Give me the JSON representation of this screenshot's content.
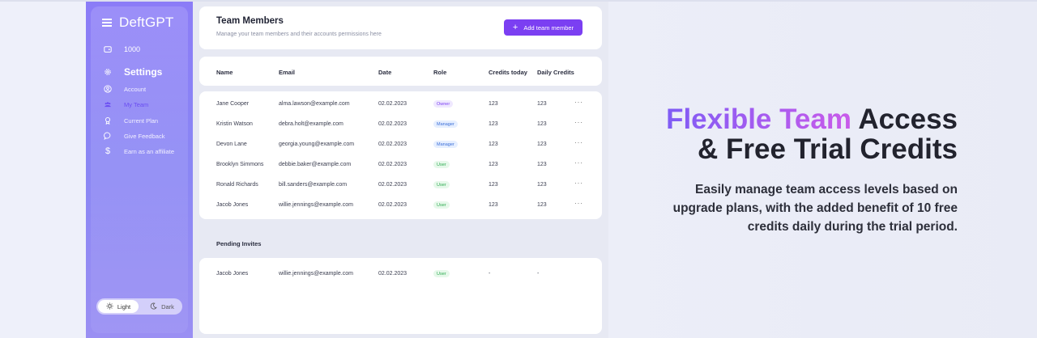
{
  "brand": {
    "name": "DeftGPT"
  },
  "credits": {
    "value": "1000"
  },
  "nav": {
    "heading": "Settings",
    "items": [
      {
        "label": "Account",
        "icon": "account-icon"
      },
      {
        "label": "My Team",
        "icon": "team-icon",
        "active": true
      },
      {
        "label": "Current Plan",
        "icon": "plan-icon"
      },
      {
        "label": "Give Feedback",
        "icon": "feedback-icon"
      },
      {
        "label": "Earn as an affiliate",
        "icon": "dollar-icon"
      }
    ]
  },
  "theme": {
    "light": "Light",
    "dark": "Dark"
  },
  "header": {
    "title": "Team Members",
    "subtitle": "Manage your team members and their accounts permissions here",
    "add_button": "Add team member"
  },
  "table": {
    "columns": [
      "Name",
      "Email",
      "Date",
      "Role",
      "Credits today",
      "Daily Credits"
    ],
    "rows": [
      {
        "name": "Jane Cooper",
        "email": "alma.lawson@example.com",
        "date": "02.02.2023",
        "role": "Owner",
        "credits_today": "123",
        "daily_credits": "123"
      },
      {
        "name": "Kristin Watson",
        "email": "debra.holt@example.com",
        "date": "02.02.2023",
        "role": "Manager",
        "credits_today": "123",
        "daily_credits": "123"
      },
      {
        "name": "Devon Lane",
        "email": "georgia.young@example.com",
        "date": "02.02.2023",
        "role": "Manager",
        "credits_today": "123",
        "daily_credits": "123"
      },
      {
        "name": "Brooklyn Simmons",
        "email": "debbie.baker@example.com",
        "date": "02.02.2023",
        "role": "User",
        "credits_today": "123",
        "daily_credits": "123"
      },
      {
        "name": "Ronald Richards",
        "email": "bill.sanders@example.com",
        "date": "02.02.2023",
        "role": "User",
        "credits_today": "123",
        "daily_credits": "123"
      },
      {
        "name": "Jacob Jones",
        "email": "willie.jennings@example.com",
        "date": "02.02.2023",
        "role": "User",
        "credits_today": "123",
        "daily_credits": "123"
      }
    ]
  },
  "pending": {
    "title": "Pending Invites",
    "rows": [
      {
        "name": "Jacob Jones",
        "email": "willie.jennings@example.com",
        "date": "02.02.2023",
        "role": "User",
        "credits_today": "-",
        "daily_credits": "-"
      }
    ]
  },
  "marketing": {
    "headline_gradient": "Flexible Team",
    "headline_rest": "Access",
    "headline_line2": "& Free Trial Credits",
    "body": "Easily manage team access levels based on upgrade plans, with the added benefit of 10 free credits daily during the trial period."
  },
  "colors": {
    "accent": "#7b3ff2",
    "owner_badge": "#7b3ff2",
    "manager_badge": "#3b6fd8",
    "user_badge": "#2fab52"
  }
}
